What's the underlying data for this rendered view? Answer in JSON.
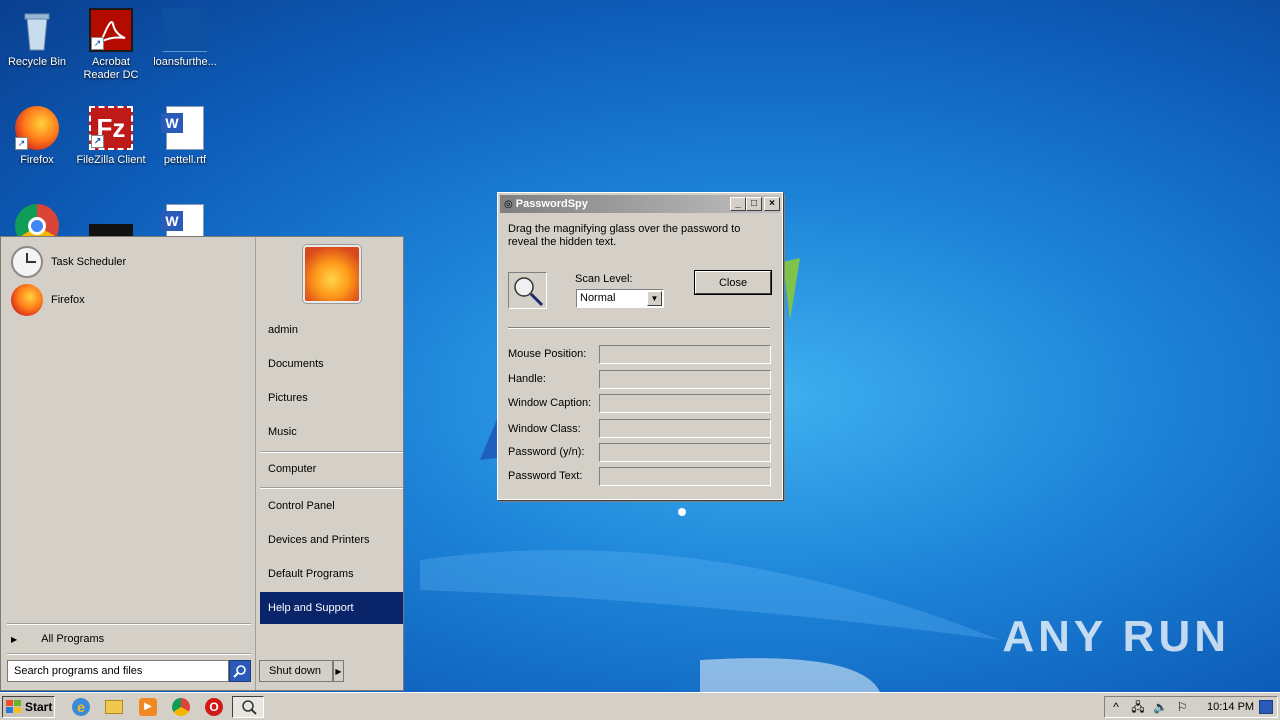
{
  "desktop": {
    "icons": [
      {
        "label": "Recycle Bin",
        "icon": "recycle-bin-icon"
      },
      {
        "label": "Acrobat Reader DC",
        "icon": "acrobat-icon"
      },
      {
        "label": "loansfurthe...",
        "icon": "file-icon"
      },
      {
        "label": "Firefox",
        "icon": "firefox-icon"
      },
      {
        "label": "FileZilla Client",
        "icon": "filezilla-icon"
      },
      {
        "label": "pettell.rtf",
        "icon": "word-doc-icon"
      }
    ],
    "watermark": "ANY RUN"
  },
  "start_menu": {
    "pinned": [
      {
        "label": "Task Scheduler",
        "icon": "clock-icon"
      },
      {
        "label": "Firefox",
        "icon": "firefox-icon"
      }
    ],
    "all_programs": "All Programs",
    "search_placeholder": "Search programs and files",
    "right_items": {
      "user": "admin",
      "documents": "Documents",
      "pictures": "Pictures",
      "music": "Music",
      "computer": "Computer",
      "control_panel": "Control Panel",
      "devices": "Devices and Printers",
      "default_programs": "Default Programs",
      "help": "Help and Support"
    },
    "shutdown": "Shut down"
  },
  "dialog": {
    "title": "PasswordSpy",
    "description": "Drag the magnifying glass over the password to reveal the hidden text.",
    "scan_level_label": "Scan Level:",
    "scan_level_value": "Normal",
    "close_button": "Close",
    "fields": {
      "mouse_position": "Mouse Position:",
      "handle": "Handle:",
      "window_caption": "Window Caption:",
      "window_class": "Window Class:",
      "password_yn": "Password (y/n):",
      "password_text": "Password Text:"
    }
  },
  "taskbar": {
    "start": "Start",
    "clock": "10:14 PM"
  },
  "colors": {
    "desktop_blue": "#1d84d8",
    "highlight": "#0a246a",
    "chrome": "#d4d0c8"
  }
}
